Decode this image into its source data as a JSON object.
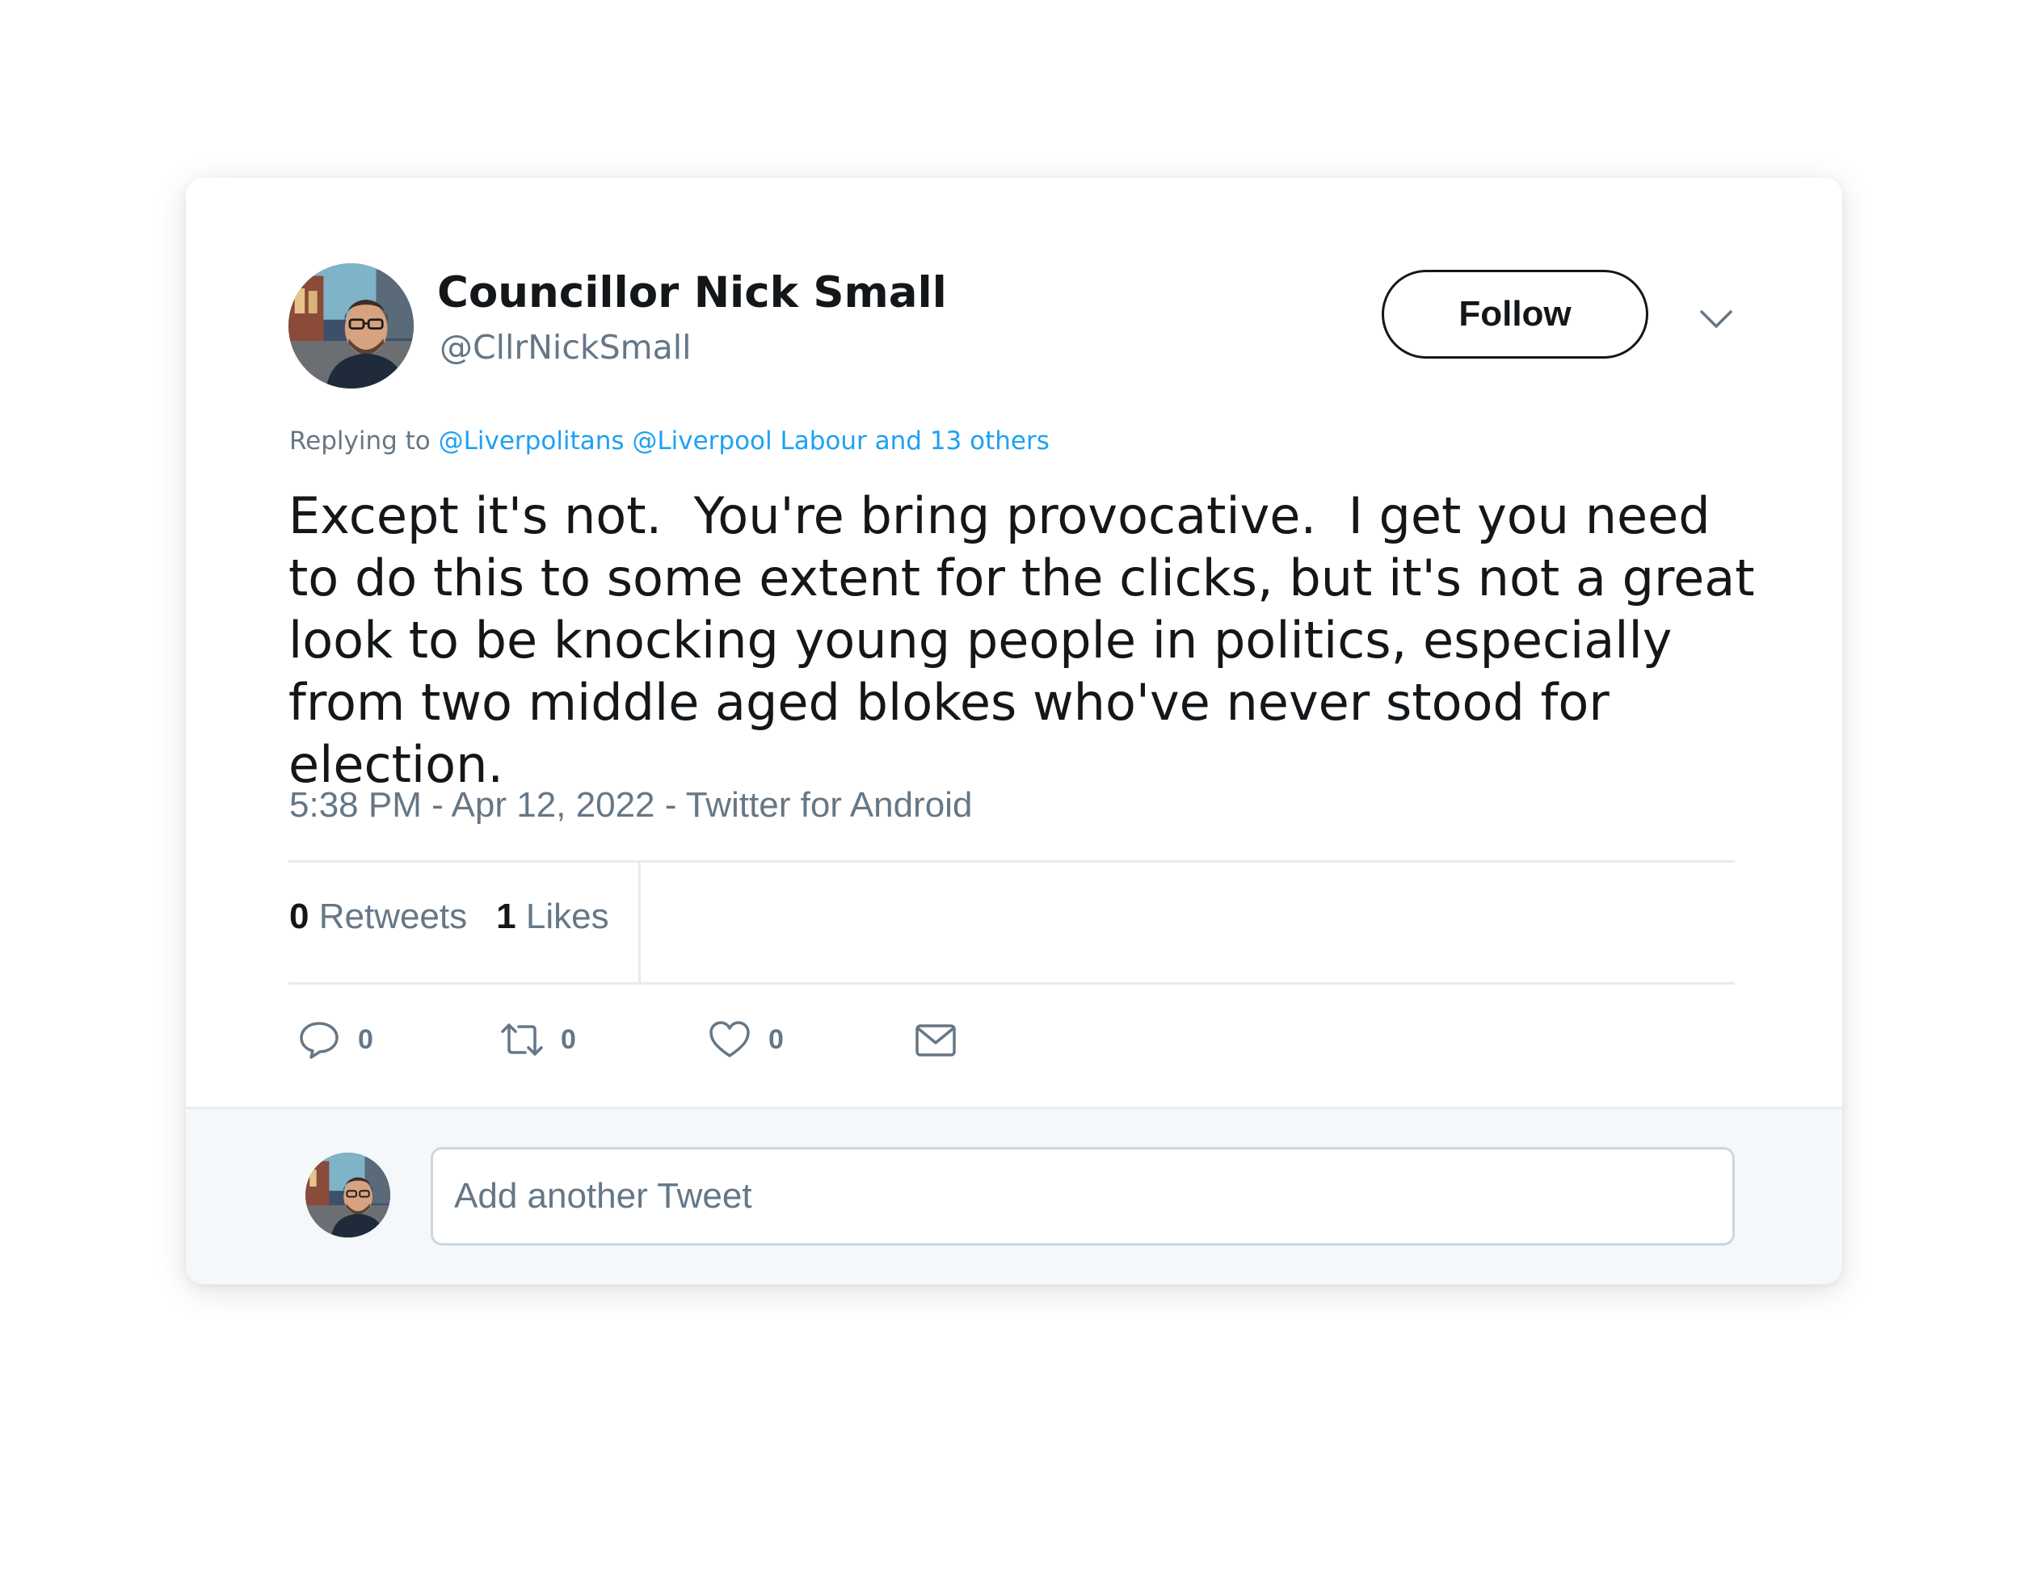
{
  "user": {
    "display_name": "Councillor Nick Small",
    "handle": "@CllrNickSmall"
  },
  "follow_label": "Follow",
  "reply": {
    "prefix": "Replying to ",
    "mentions": "@Liverpolitans @Liverpool Labour and 13 others"
  },
  "tweet": {
    "text": "Except it's not.  You're bring provocative.  I get you need to do this to some extent for the clicks, but it's not a great look to be knocking young people in politics, especially from two middle aged blokes who've never stood for election.",
    "meta": "5:38 PM - Apr 12, 2022 - Twitter for Android"
  },
  "stats": {
    "retweets_count": "0",
    "retweets_label": "Retweets",
    "likes_count": "1",
    "likes_label": "Likes"
  },
  "actions": {
    "reply_count": "0",
    "retweet_count": "0",
    "like_count": "0"
  },
  "compose": {
    "placeholder": "Add another Tweet"
  },
  "icons": [
    "chevron-down-icon",
    "reply-icon",
    "retweet-icon",
    "like-icon",
    "mail-icon"
  ],
  "colors": {
    "text": "#14171a",
    "secondary": "#657786",
    "link": "#1da1f2",
    "divider": "#e6ecf0",
    "compose_bg": "#f5f8fa"
  }
}
